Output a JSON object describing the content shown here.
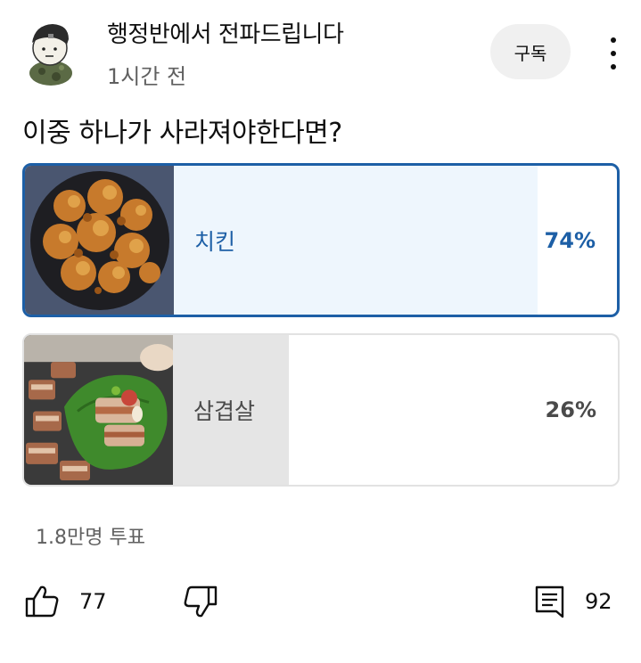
{
  "header": {
    "channel_name": "행정반에서 전파드립니다",
    "time": "1시간 전",
    "subscribe_label": "구독",
    "avatar_icon": "soldier-avatar"
  },
  "poll": {
    "question": "이중 하나가 사라져야한다면?",
    "options": [
      {
        "label": "치킨",
        "percent_text": "74%",
        "percent": 74,
        "selected": true,
        "image": "fried-chicken-photo"
      },
      {
        "label": "삼겹살",
        "percent_text": "26%",
        "percent": 26,
        "selected": false,
        "image": "samgyeopsal-photo"
      }
    ],
    "votes": "1.8만명 투표"
  },
  "actions": {
    "like_count": "77",
    "comment_count": "92",
    "like_icon": "thumbs-up-icon",
    "dislike_icon": "thumbs-down-icon",
    "comment_icon": "comment-icon"
  },
  "colors": {
    "accent": "#1d5fa6",
    "selected_fill": "#eef6fd",
    "unselected_fill": "#e5e5e5",
    "subscribe_bg": "#f0f0f0"
  }
}
